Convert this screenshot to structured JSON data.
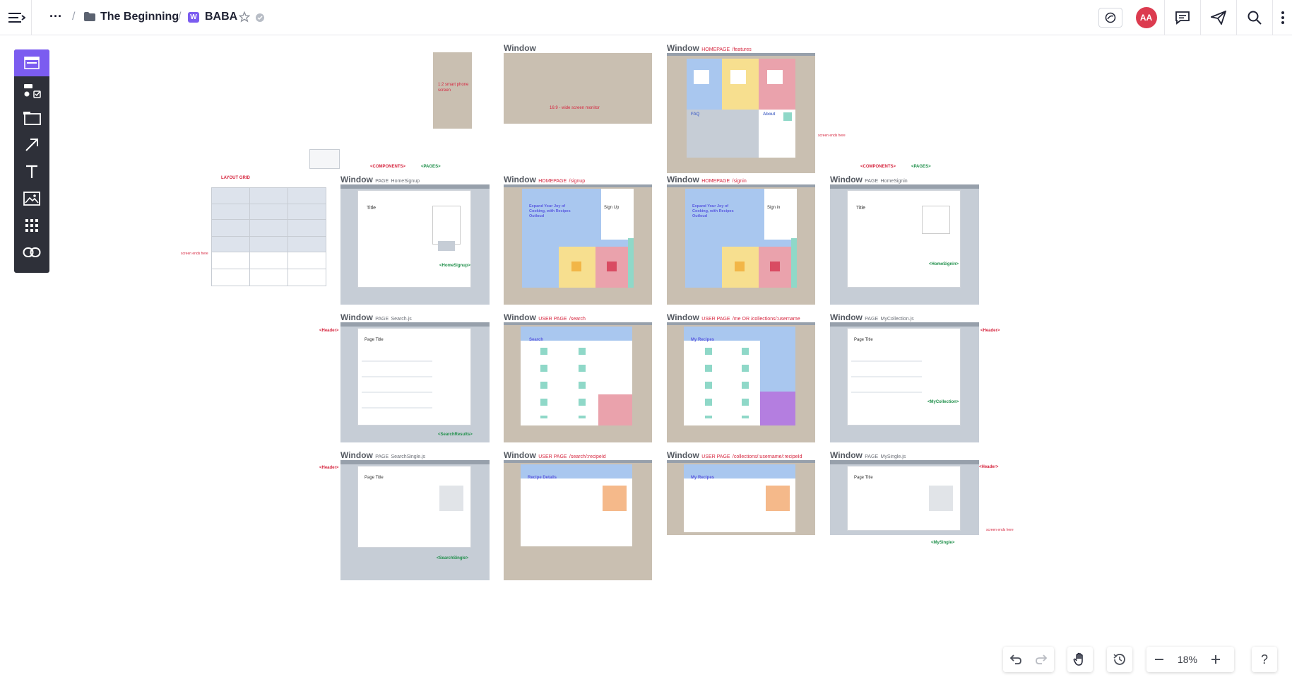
{
  "topbar": {
    "breadcrumb": [
      "The Beginning",
      "BABA"
    ],
    "board_badge": "W",
    "more_label": "···",
    "avatar_initials": "AA"
  },
  "zoom": {
    "value": "18%"
  },
  "help_label": "?",
  "canvas": {
    "window_label": "Window",
    "phone_note": "1:2 smart phone screen",
    "monitor_note": "16:9 - wide screen monitor",
    "layout_grid": "LAYOUT GRID",
    "components_tag": "<COMPONENTS>",
    "pages_tag": "<PAGES>",
    "header_tag": "<Header>",
    "screen_ends": "screen ends here",
    "frames": [
      {
        "prefix": "HOMEPAGE",
        "path": "/features"
      },
      {
        "prefix": "PAGE",
        "path": "HomeSignup"
      },
      {
        "prefix": "HOMEPAGE",
        "path": "/signup"
      },
      {
        "prefix": "HOMEPAGE",
        "path": "/signin"
      },
      {
        "prefix": "PAGE",
        "path": "HomeSignin"
      },
      {
        "prefix": "PAGE",
        "path": "Search.js"
      },
      {
        "prefix": "USER PAGE",
        "path": "/search"
      },
      {
        "prefix": "USER PAGE",
        "path": "/me  OR  /collections/:username"
      },
      {
        "prefix": "PAGE",
        "path": "MyCollection.js"
      },
      {
        "prefix": "PAGE",
        "path": "SearchSingle.js"
      },
      {
        "prefix": "USER PAGE",
        "path": "/search/:recipeId"
      },
      {
        "prefix": "USER PAGE",
        "path": "/collections/:username/:recipeId"
      },
      {
        "prefix": "PAGE",
        "path": "MySingle.js"
      }
    ],
    "component_tags": [
      "<HomeSignup>",
      "<HomeSignin>",
      "<SearchResults>",
      "<MyCollection>",
      "<SearchSingle>",
      "<MySingle>"
    ],
    "mock_text": {
      "title": "Title",
      "page_title": "Page Title",
      "sign_up": "Sign Up",
      "sign_in": "Sign in",
      "expand": "Expand Your Joy of Cooking, with Recipes Outloud",
      "search": "Search",
      "my_recipes": "My Recipes",
      "recipe_details": "Recipe Details",
      "faq": "FAQ",
      "about": "About"
    }
  },
  "colors": {
    "accent": "#7b5cf0",
    "frame": "#c6cdd6",
    "beige": "#c9bfb1",
    "red_note": "#d6263f",
    "green_note": "#1f8f4a"
  }
}
